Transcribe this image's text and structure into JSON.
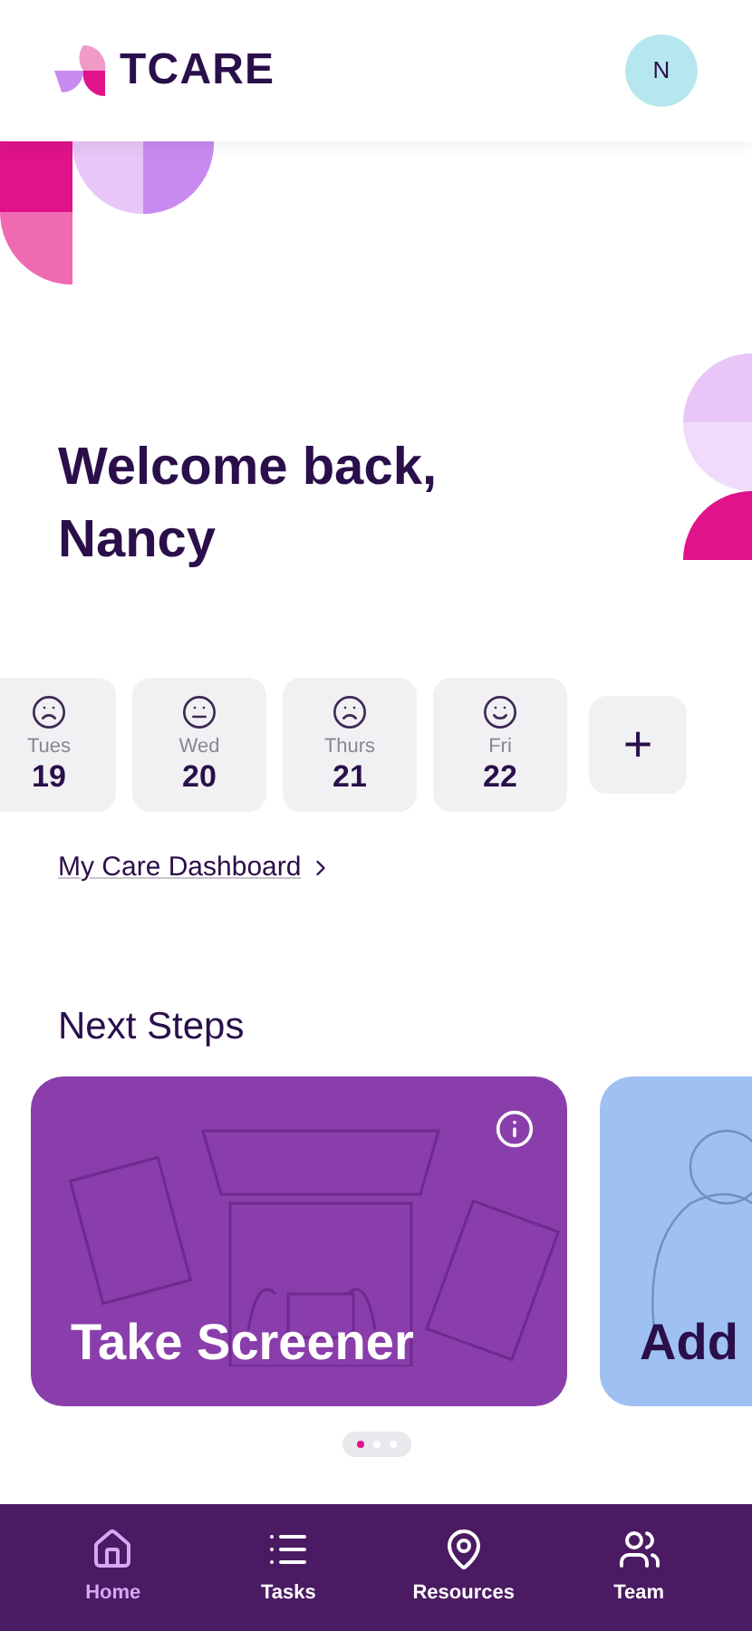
{
  "header": {
    "brand": "TCARE",
    "avatar_initial": "N"
  },
  "greeting": {
    "line1": "Welcome back,",
    "line2": "Nancy"
  },
  "days": [
    {
      "day": "Tues",
      "date": "19",
      "kind": "sad"
    },
    {
      "day": "Wed",
      "date": "20",
      "kind": "neutral"
    },
    {
      "day": "Thurs",
      "date": "21",
      "kind": "sad"
    },
    {
      "day": "Fri",
      "date": "22",
      "kind": "happy"
    }
  ],
  "add_button": "+",
  "dashboard_link": "My Care Dashboard",
  "section_title": "Next Steps",
  "steps": [
    {
      "title": "Take Screener",
      "kind": "laptop",
      "color": "#8a3eab"
    },
    {
      "title": "Add",
      "kind": "person",
      "color": "#9fc0f2"
    }
  ],
  "pager": [
    {
      "selected": true
    },
    {
      "selected": false
    },
    {
      "selected": false
    }
  ],
  "nav": [
    {
      "label": "Home",
      "kind": "home",
      "selected": true
    },
    {
      "label": "Tasks",
      "kind": "list",
      "selected": false
    },
    {
      "label": "Resources",
      "kind": "pin",
      "selected": false
    },
    {
      "label": "Team",
      "kind": "team",
      "selected": false
    }
  ]
}
